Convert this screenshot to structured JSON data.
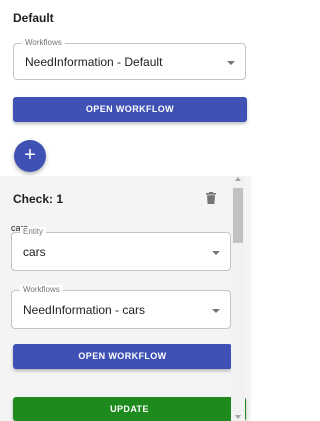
{
  "section": {
    "title": "Default"
  },
  "default_workflow": {
    "legend": "Workflows",
    "value": "NeedInformation - Default"
  },
  "open_workflow_label": "OPEN WORKFLOW",
  "fab_label": "+",
  "check": {
    "title": "Check: 1",
    "name": "cars",
    "entity": {
      "legend": "Entity",
      "value": "cars"
    },
    "workflow": {
      "legend": "Workflows",
      "value": "NeedInformation - cars"
    },
    "open_workflow_label": "OPEN WORKFLOW"
  },
  "update_label": "UPDATE",
  "icons": [
    "trash-icon",
    "plus-icon",
    "chevron-down-icon",
    "scroll-arrow-up-icon",
    "scroll-arrow-down-icon"
  ],
  "colors": {
    "primary": "#3f51b5",
    "success": "#1e8a1e",
    "panel": "#f4f4f4"
  }
}
